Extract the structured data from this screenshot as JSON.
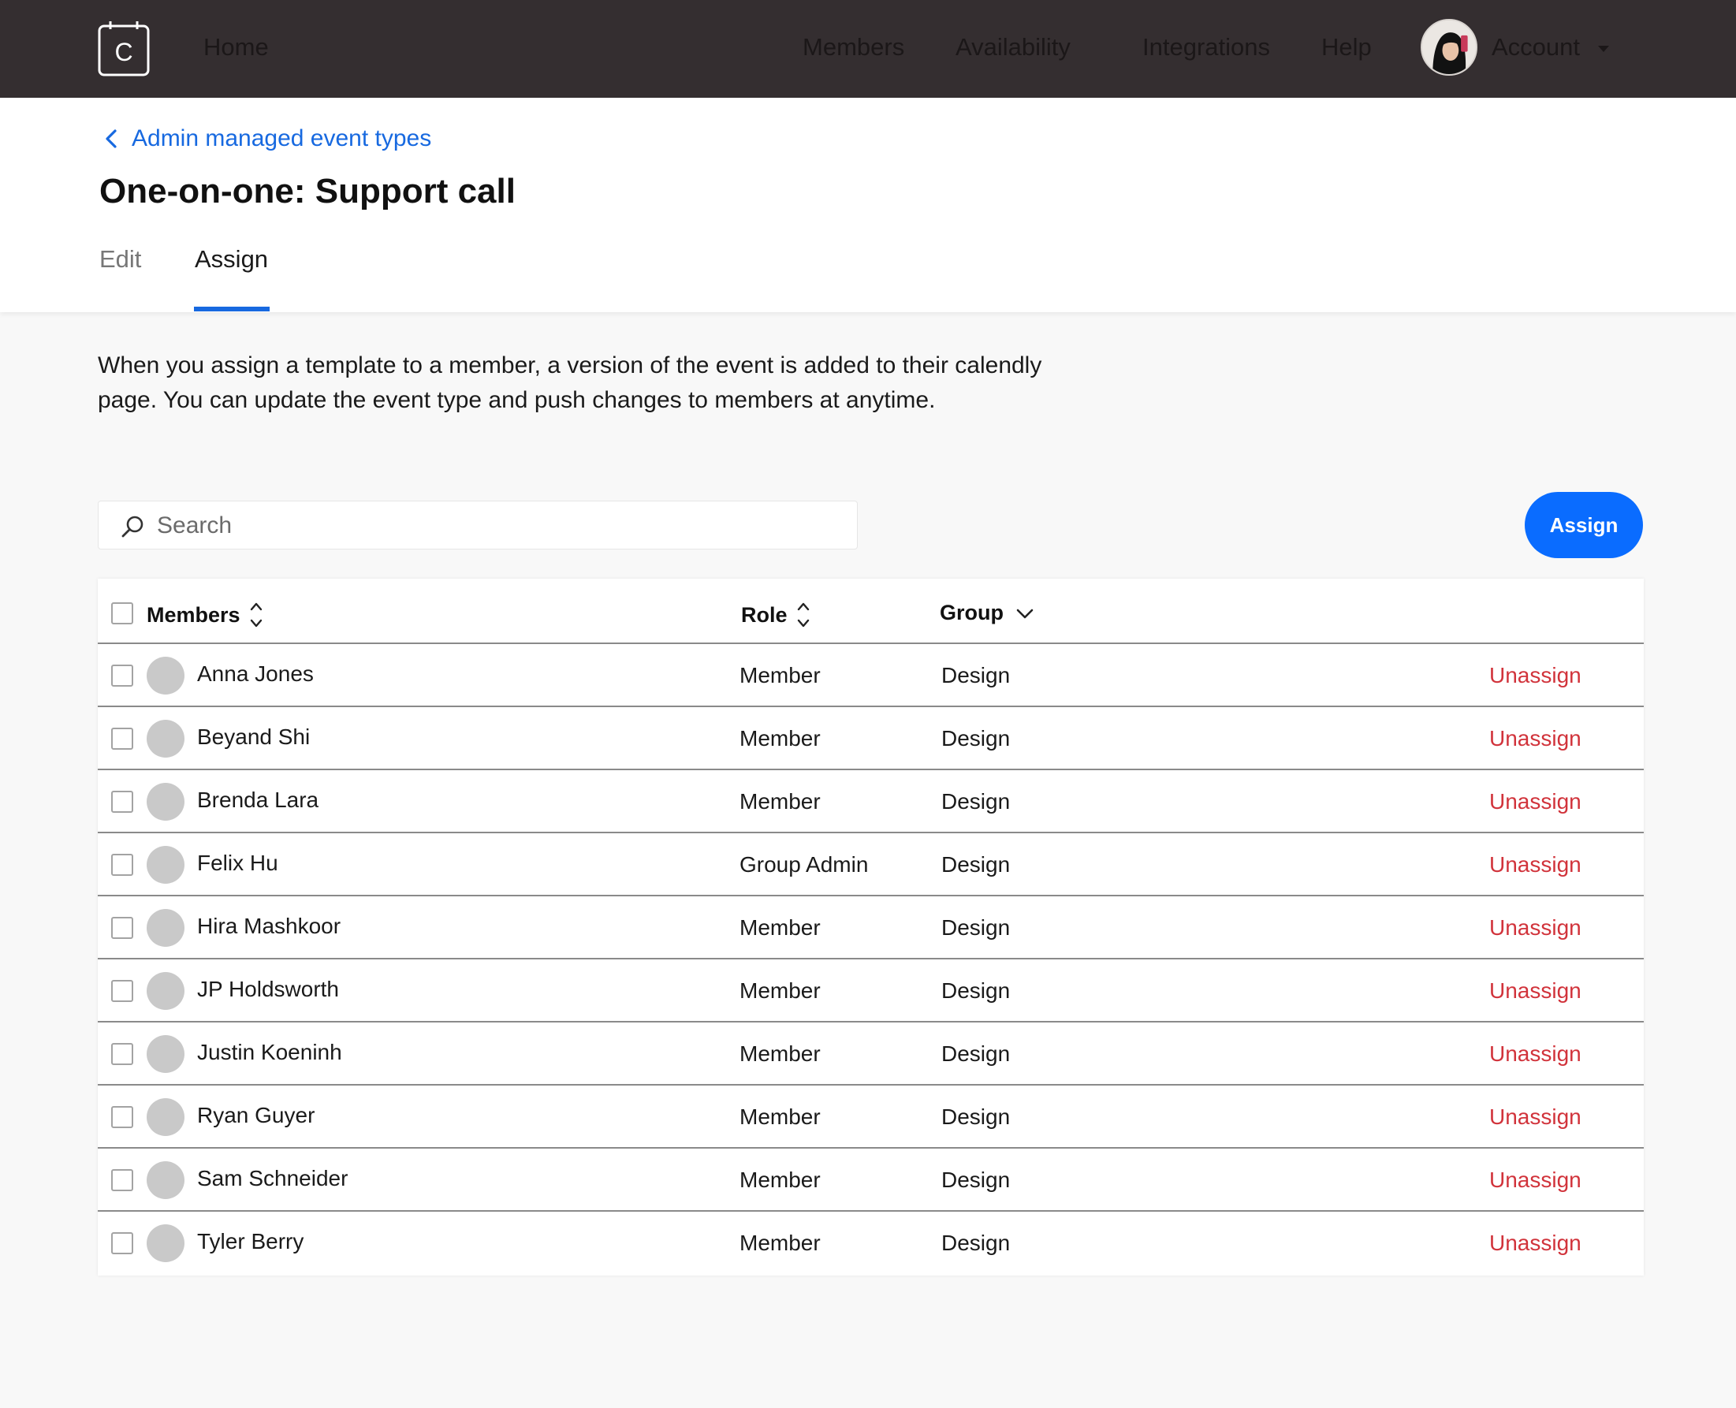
{
  "nav": {
    "logo_letter": "C",
    "home": "Home",
    "members": "Members",
    "availability": "Availability",
    "integrations": "Integrations",
    "help": "Help",
    "account": "Account"
  },
  "breadcrumb": {
    "label": "Admin managed event types"
  },
  "page_title": "One-on-one: Support call",
  "tabs": {
    "edit": "Edit",
    "assign": "Assign",
    "active": "Assign"
  },
  "description": "When you assign a template to a member, a version of the event is added to their calendly page. You can update the event type and push changes to members at anytime.",
  "search": {
    "placeholder": "Search",
    "value": ""
  },
  "assign_button": "Assign",
  "table": {
    "headers": {
      "members": "Members",
      "role": "Role",
      "group": "Group"
    },
    "rows": [
      {
        "name": "Anna Jones",
        "role": "Member",
        "group": "Design",
        "action": "Unassign"
      },
      {
        "name": "Beyand Shi",
        "role": "Member",
        "group": "Design",
        "action": "Unassign"
      },
      {
        "name": "Brenda Lara",
        "role": "Member",
        "group": "Design",
        "action": "Unassign"
      },
      {
        "name": "Felix Hu",
        "role": "Group Admin",
        "group": "Design",
        "action": "Unassign"
      },
      {
        "name": "Hira Mashkoor",
        "role": "Member",
        "group": "Design",
        "action": "Unassign"
      },
      {
        "name": "JP Holdsworth",
        "role": "Member",
        "group": "Design",
        "action": "Unassign"
      },
      {
        "name": "Justin Koeninh",
        "role": "Member",
        "group": "Design",
        "action": "Unassign"
      },
      {
        "name": "Ryan Guyer",
        "role": "Member",
        "group": "Design",
        "action": "Unassign"
      },
      {
        "name": "Sam Schneider",
        "role": "Member",
        "group": "Design",
        "action": "Unassign"
      },
      {
        "name": "Tyler Berry",
        "role": "Member",
        "group": "Design",
        "action": "Unassign"
      }
    ]
  },
  "colors": {
    "nav_bg": "#342e30",
    "accent": "#0a6cff",
    "link": "#1769e0",
    "danger": "#d1333b",
    "page_bg": "#f8f8f8"
  }
}
